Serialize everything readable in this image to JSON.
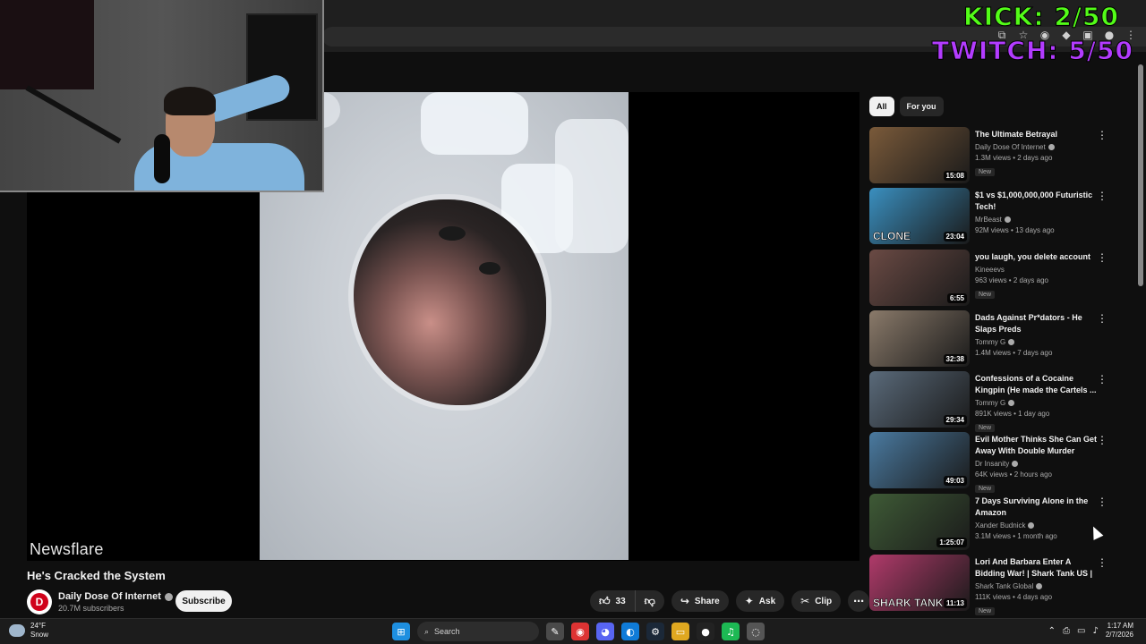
{
  "overlays": {
    "kick": "KICK: 2/50",
    "twitch": "TWITCH: 5/50"
  },
  "video": {
    "watermark": "Newsflare",
    "title": "He's Cracked the System",
    "channel": {
      "name": "Daily Dose Of Internet",
      "subscribers": "20.7M subscribers",
      "avatar_letter": "D"
    },
    "subscribe_label": "Subscribe",
    "likes": "33",
    "share_label": "Share",
    "ask_label": "Ask",
    "clip_label": "Clip"
  },
  "chips": [
    {
      "label": "All",
      "active": true
    },
    {
      "label": "For you",
      "active": false
    }
  ],
  "recommendations": [
    {
      "title": "The Ultimate Betrayal",
      "channel": "Daily Dose Of Internet",
      "verified": true,
      "stats": "1.3M views • 2 days ago",
      "badge": "New",
      "duration": "15:08",
      "thumb": "#7a5a3a",
      "overlay": ""
    },
    {
      "title": "$1 vs $1,000,000,000 Futuristic Tech!",
      "channel": "MrBeast",
      "verified": true,
      "stats": "92M views • 13 days ago",
      "badge": "",
      "duration": "23:04",
      "thumb": "#3a8fbf",
      "overlay": "CLONE"
    },
    {
      "title": "you laugh, you delete account",
      "channel": "Kineeevs",
      "verified": false,
      "stats": "963 views • 2 days ago",
      "badge": "New",
      "duration": "6:55",
      "thumb": "#6a4a44",
      "overlay": ""
    },
    {
      "title": "Dads Against Pr*dators - He Slaps Preds",
      "channel": "Tommy G",
      "verified": true,
      "stats": "1.4M views • 7 days ago",
      "badge": "",
      "duration": "32:38",
      "thumb": "#8a7a6a",
      "overlay": ""
    },
    {
      "title": "Confessions of a Cocaine Kingpin (He made the Cartels ...",
      "channel": "Tommy G",
      "verified": true,
      "stats": "891K views • 1 day ago",
      "badge": "New",
      "duration": "29:34",
      "thumb": "#5a6a7a",
      "overlay": ""
    },
    {
      "title": "Evil Mother Thinks She Can Get Away With Double Murder",
      "channel": "Dr Insanity",
      "verified": true,
      "stats": "64K views • 2 hours ago",
      "badge": "New",
      "duration": "49:03",
      "thumb": "#4a7aa0",
      "overlay": ""
    },
    {
      "title": "7 Days Surviving Alone in the Amazon",
      "channel": "Xander Budnick",
      "verified": true,
      "stats": "3.1M views • 1 month ago",
      "badge": "",
      "duration": "1:25:07",
      "thumb": "#3e5a36",
      "overlay": ""
    },
    {
      "title": "Lori And Barbara Enter A Bidding War! | Shark Tank US | ...",
      "channel": "Shark Tank Global",
      "verified": true,
      "stats": "111K views • 4 days ago",
      "badge": "New",
      "duration": "11:13",
      "thumb": "#b03a6a",
      "overlay": "SHARK TANK"
    }
  ],
  "taskbar": {
    "weather_temp": "24°F",
    "weather_desc": "Snow",
    "search_placeholder": "Search",
    "time": "1:17 AM",
    "date": "2/7/2026"
  },
  "icons": [
    "windows-icon",
    "search-icon",
    "file-explorer-icon",
    "chrome-icon",
    "discord-icon",
    "edge-icon",
    "steam-icon",
    "folder-icon",
    "obs-icon",
    "spotify-icon",
    "app-icon"
  ],
  "colors": {
    "kick": "#53fc18",
    "twitch": "#b33cff",
    "youtube_bg": "#0f0f0f"
  }
}
